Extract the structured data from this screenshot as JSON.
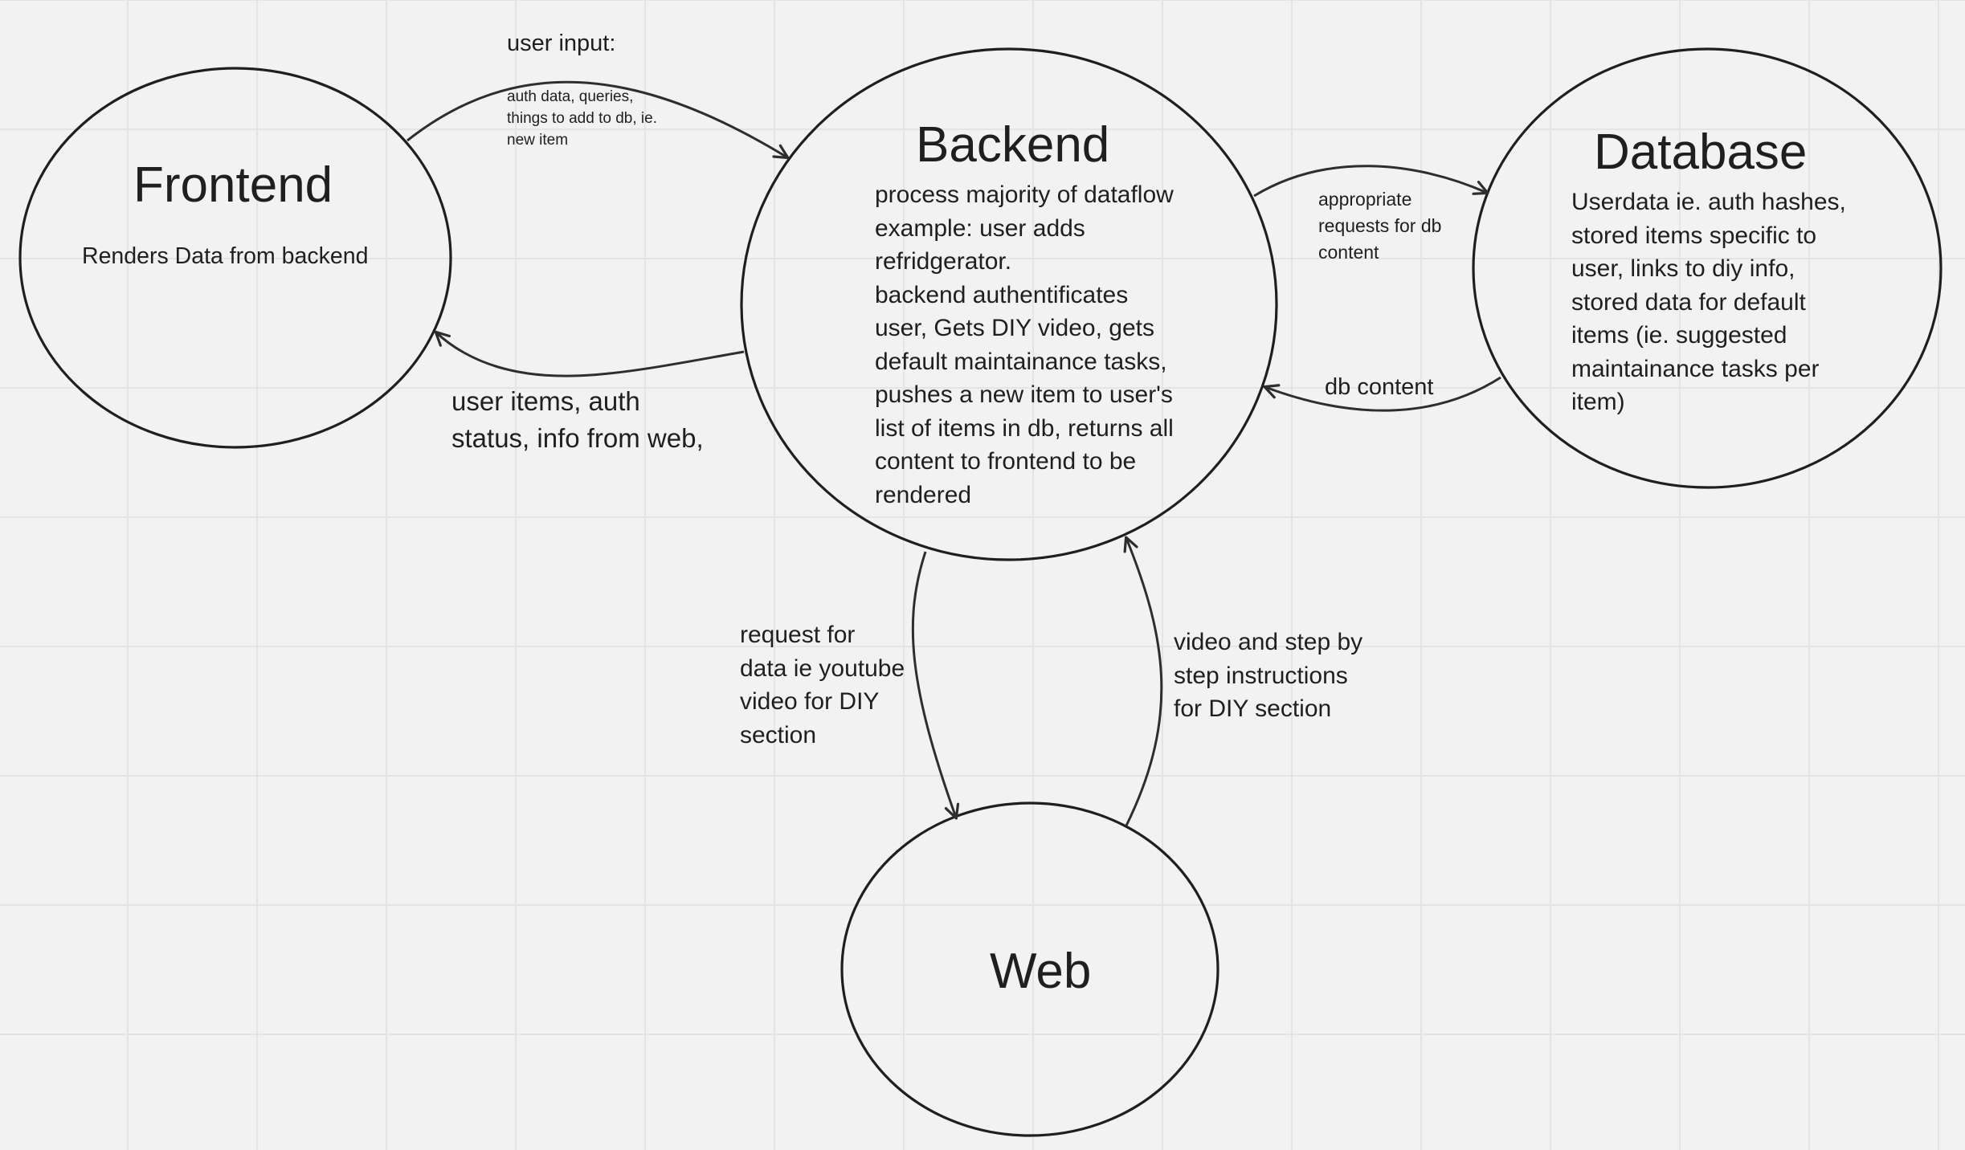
{
  "nodes": {
    "frontend": {
      "title": "Frontend",
      "desc": "Renders Data from backend"
    },
    "backend": {
      "title": "Backend",
      "desc": "process majority of dataflow\nexample: user adds\nrefridgerator.\nbackend authentificates\nuser, Gets DIY video, gets\ndefault maintainance tasks,\npushes a new item to user's\nlist of items in db, returns all\ncontent to frontend to be\nrendered"
    },
    "database": {
      "title": "Database",
      "desc": "Userdata ie. auth hashes,\nstored items specific to\nuser, links to diy info,\nstored data for default\nitems (ie. suggested\nmaintainance tasks per\nitem)"
    },
    "web": {
      "title": "Web"
    }
  },
  "edges": {
    "frontend_to_backend": {
      "heading": "user input:",
      "detail": "auth data, queries,\nthings to add to db, ie.\nnew item"
    },
    "backend_to_frontend": {
      "label": "user items, auth\nstatus, info from web,"
    },
    "backend_to_database": {
      "label": "appropriate\nrequests for db\ncontent"
    },
    "database_to_backend": {
      "label": "db content"
    },
    "backend_to_web": {
      "label": "request for\ndata ie youtube\nvideo for DIY\nsection"
    },
    "web_to_backend": {
      "label": "video and step by\nstep instructions\nfor DIY section"
    }
  }
}
